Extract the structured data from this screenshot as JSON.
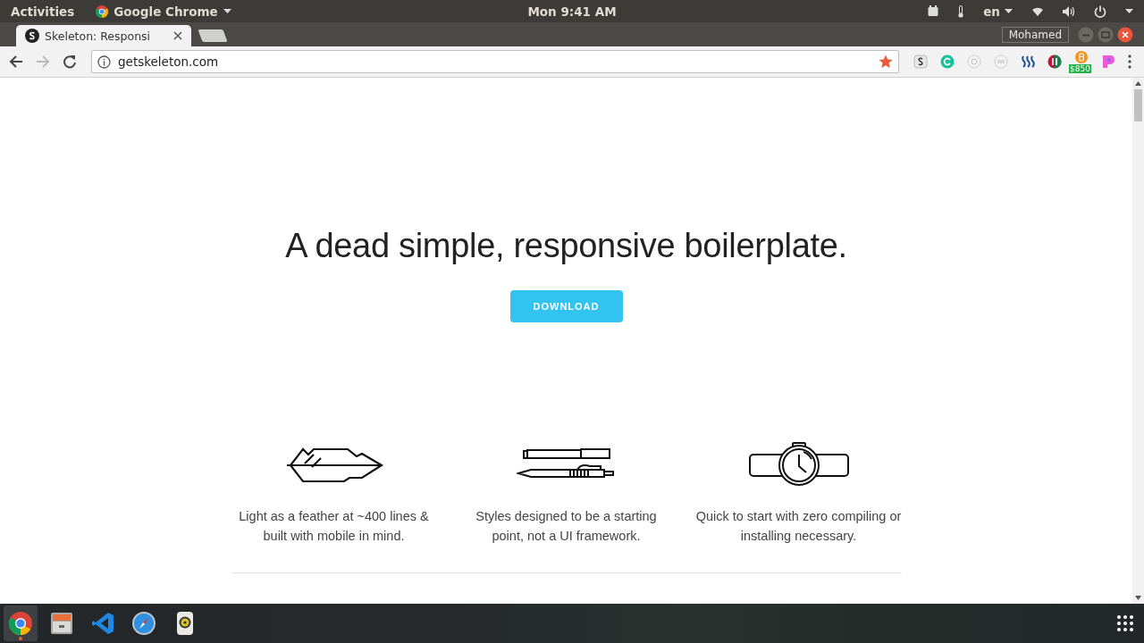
{
  "top_bar": {
    "activities": "Activities",
    "app_menu": "Google Chrome",
    "clock": "Mon  9:41 AM",
    "language": "en"
  },
  "browser": {
    "tabs": [
      {
        "title": "Skeleton: Responsi",
        "selected": true
      }
    ],
    "profile": "Mohamed",
    "address": "getskeleton.com",
    "bookmarked": true,
    "extensions": [
      {
        "kind": "square-s"
      },
      {
        "kind": "green-circle"
      },
      {
        "kind": "grey-vp"
      },
      {
        "kind": "grey-w"
      },
      {
        "kind": "blue-waves"
      },
      {
        "kind": "red-green-bars"
      },
      {
        "kind": "orange-coin",
        "badge": "$850"
      },
      {
        "kind": "pink-p"
      }
    ]
  },
  "page": {
    "heading": "A dead simple, responsive boilerplate.",
    "button": "DOWNLOAD",
    "features": [
      {
        "kind": "feather",
        "text": "Light as a feather at ~400 lines & built with mobile in mind."
      },
      {
        "kind": "pens",
        "text": "Styles designed to be a starting point, not a UI framework."
      },
      {
        "kind": "watch",
        "text": "Quick to start with zero compiling or installing necessary."
      }
    ]
  },
  "dock": {
    "apps": [
      {
        "kind": "browser",
        "selected": true,
        "running": true
      },
      {
        "kind": "files",
        "selected": false,
        "running": false
      },
      {
        "kind": "editor",
        "selected": false,
        "running": false
      },
      {
        "kind": "compass",
        "selected": false,
        "running": false
      },
      {
        "kind": "speaker",
        "selected": false,
        "running": false
      }
    ]
  }
}
